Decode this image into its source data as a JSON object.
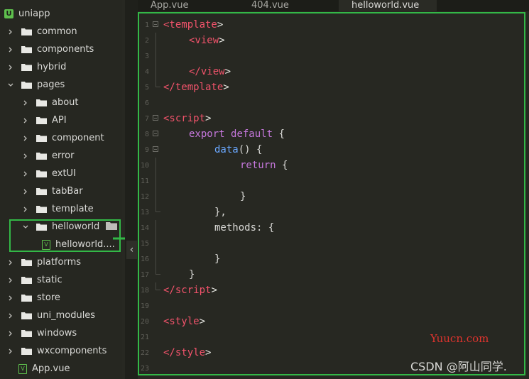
{
  "explorer": {
    "root": {
      "label": "uniapp",
      "icon": "uni-app-logo-icon"
    },
    "items": [
      {
        "label": "common",
        "depth": 0,
        "type": "folder",
        "expanded": false
      },
      {
        "label": "components",
        "depth": 0,
        "type": "folder",
        "expanded": false
      },
      {
        "label": "hybrid",
        "depth": 0,
        "type": "folder",
        "expanded": false
      },
      {
        "label": "pages",
        "depth": 0,
        "type": "folder",
        "expanded": true
      },
      {
        "label": "about",
        "depth": 1,
        "type": "folder",
        "expanded": false
      },
      {
        "label": "API",
        "depth": 1,
        "type": "folder",
        "expanded": false
      },
      {
        "label": "component",
        "depth": 1,
        "type": "folder",
        "expanded": false
      },
      {
        "label": "error",
        "depth": 1,
        "type": "folder",
        "expanded": false
      },
      {
        "label": "extUI",
        "depth": 1,
        "type": "folder",
        "expanded": false
      },
      {
        "label": "tabBar",
        "depth": 1,
        "type": "folder",
        "expanded": false
      },
      {
        "label": "template",
        "depth": 1,
        "type": "folder",
        "expanded": false
      },
      {
        "label": "helloworld",
        "depth": 1,
        "type": "folder",
        "expanded": true
      },
      {
        "label": "helloworld....",
        "depth": 2,
        "type": "vue-file"
      },
      {
        "label": "platforms",
        "depth": 0,
        "type": "folder",
        "expanded": false
      },
      {
        "label": "static",
        "depth": 0,
        "type": "folder",
        "expanded": false
      },
      {
        "label": "store",
        "depth": 0,
        "type": "folder",
        "expanded": false
      },
      {
        "label": "uni_modules",
        "depth": 0,
        "type": "folder",
        "expanded": false
      },
      {
        "label": "windows",
        "depth": 0,
        "type": "folder",
        "expanded": false
      },
      {
        "label": "wxcomponents",
        "depth": 0,
        "type": "folder",
        "expanded": false
      },
      {
        "label": "App.vue",
        "depth": 0,
        "type": "vue-file"
      }
    ]
  },
  "tabs": [
    {
      "label": "App.vue",
      "active": false
    },
    {
      "label": "404.vue",
      "active": false
    },
    {
      "label": "helloworld.vue",
      "active": true
    }
  ],
  "editor": {
    "lines": [
      {
        "n": "1",
        "fold": "box",
        "indent": 0,
        "tokens": [
          [
            "tag",
            "<template"
          ],
          [
            "br",
            ">"
          ]
        ]
      },
      {
        "n": "2",
        "fold": "line",
        "indent": 1,
        "tokens": [
          [
            "tag",
            "<view"
          ],
          [
            "br",
            ">"
          ]
        ]
      },
      {
        "n": "3",
        "fold": "line",
        "indent": 0,
        "tokens": []
      },
      {
        "n": "4",
        "fold": "line",
        "indent": 1,
        "tokens": [
          [
            "tag",
            "</view"
          ],
          [
            "br",
            ">"
          ]
        ]
      },
      {
        "n": "5",
        "fold": "end",
        "indent": 0,
        "tokens": [
          [
            "tag",
            "</template"
          ],
          [
            "br",
            ">"
          ]
        ]
      },
      {
        "n": "6",
        "fold": "",
        "indent": 0,
        "tokens": []
      },
      {
        "n": "7",
        "fold": "box",
        "indent": 0,
        "tokens": [
          [
            "tag",
            "<script"
          ],
          [
            "br",
            ">"
          ]
        ]
      },
      {
        "n": "8",
        "fold": "box",
        "indent": 1,
        "tokens": [
          [
            "kw",
            "export"
          ],
          [
            "pl",
            " "
          ],
          [
            "kw",
            "default"
          ],
          [
            "pl",
            " {"
          ]
        ]
      },
      {
        "n": "9",
        "fold": "box",
        "indent": 2,
        "tokens": [
          [
            "fn",
            "data"
          ],
          [
            "pl",
            "() {"
          ]
        ]
      },
      {
        "n": "10",
        "fold": "line",
        "indent": 3,
        "tokens": [
          [
            "kw",
            "return"
          ],
          [
            "pl",
            " {"
          ]
        ]
      },
      {
        "n": "11",
        "fold": "line",
        "indent": 0,
        "tokens": []
      },
      {
        "n": "12",
        "fold": "line",
        "indent": 3,
        "tokens": [
          [
            "pl",
            "}"
          ]
        ]
      },
      {
        "n": "13",
        "fold": "end",
        "indent": 2,
        "tokens": [
          [
            "pl",
            "},"
          ]
        ]
      },
      {
        "n": "14",
        "fold": "line",
        "indent": 2,
        "tokens": [
          [
            "pl",
            "methods: {"
          ]
        ]
      },
      {
        "n": "15",
        "fold": "line",
        "indent": 0,
        "tokens": []
      },
      {
        "n": "16",
        "fold": "line",
        "indent": 2,
        "tokens": [
          [
            "pl",
            "}"
          ]
        ]
      },
      {
        "n": "17",
        "fold": "end",
        "indent": 1,
        "tokens": [
          [
            "pl",
            "}"
          ]
        ]
      },
      {
        "n": "18",
        "fold": "end",
        "indent": 0,
        "tokens": [
          [
            "tag",
            "</script"
          ],
          [
            "br",
            ">"
          ]
        ]
      },
      {
        "n": "19",
        "fold": "",
        "indent": 0,
        "tokens": []
      },
      {
        "n": "20",
        "fold": "",
        "indent": 0,
        "tokens": [
          [
            "tag",
            "<style"
          ],
          [
            "br",
            ">"
          ]
        ]
      },
      {
        "n": "21",
        "fold": "",
        "indent": 0,
        "tokens": []
      },
      {
        "n": "22",
        "fold": "",
        "indent": 0,
        "tokens": [
          [
            "tag",
            "</style"
          ],
          [
            "br",
            ">"
          ]
        ]
      },
      {
        "n": "23",
        "fold": "",
        "indent": 0,
        "tokens": []
      }
    ]
  },
  "watermarks": {
    "site": "Yuucn.com",
    "author": "CSDN @阿山同学."
  },
  "colors": {
    "highlight": "#33b847",
    "tag": "#f1536b",
    "keyword": "#c678dd",
    "function": "#6aa8ff"
  }
}
